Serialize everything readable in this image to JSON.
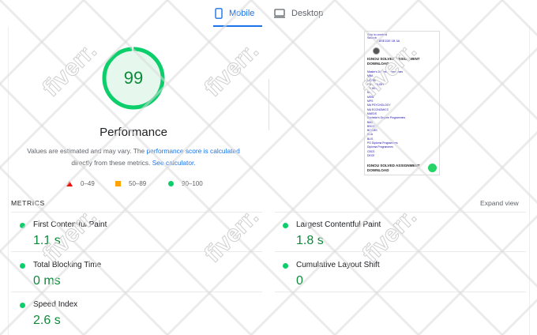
{
  "tabs": [
    {
      "label": "Mobile",
      "icon": "smartphone-icon",
      "active": true
    },
    {
      "label": "Desktop",
      "icon": "monitor-icon",
      "active": false
    }
  ],
  "score": {
    "value": "99",
    "level": 0.99,
    "label": "Performance",
    "note_part1": "Values are estimated and may vary. The ",
    "note_link1": "performance score is calculated",
    "note_part2": " directly from these metrics. ",
    "note_link2": "See calculator.",
    "color_ring": "#0cce6b",
    "color_text": "#0c8a3a"
  },
  "legend": [
    {
      "range": "0–49",
      "shape": "triangle",
      "color": "#eb0f00"
    },
    {
      "range": "50–89",
      "shape": "square",
      "color": "#ffa400"
    },
    {
      "range": "90–100",
      "shape": "circle",
      "color": "#0cce6b"
    }
  ],
  "thumbnail": {
    "top_lines": [
      "Skip to content",
      "Search",
      "CBSE1DE 1B 3A"
    ],
    "title": "IGNOU SOLVED ASSIGNMENT DOWNLOAD",
    "links": [
      "Master's Degree Programmes",
      "MBA",
      "MCOM",
      "MA ENGLISH",
      "MA HINDI",
      "MCA",
      "MSW",
      "MPS",
      "MA PSYCHOLOGY",
      "MA ECONOMICS",
      "MAEDS",
      "Bachelor's Degree Programmes",
      "BAG",
      "BSCG",
      "BCOMG",
      "BCA",
      "BLIS",
      "PG Diploma Programmes",
      "Diploma Programmes",
      "CBCS",
      "DECE"
    ],
    "bottom_title": "IGNOU SOLVED ASSIGNMENT DOWNLOAD"
  },
  "metrics": {
    "header": "METRICS",
    "expand_label": "Expand view",
    "items": [
      {
        "label": "First Contentful Paint",
        "value": "1.1 s",
        "status_color": "#0cce6b"
      },
      {
        "label": "Largest Contentful Paint",
        "value": "1.8 s",
        "status_color": "#0cce6b"
      },
      {
        "label": "Total Blocking Time",
        "value": "0 ms",
        "status_color": "#0cce6b"
      },
      {
        "label": "Cumulative Layout Shift",
        "value": "0",
        "status_color": "#0cce6b"
      },
      {
        "label": "Speed Index",
        "value": "2.6 s",
        "status_color": "#0cce6b"
      }
    ]
  },
  "watermark": {
    "text": "fiverr."
  },
  "colors": {
    "accent": "#1a73e8",
    "pass": "#0cce6b",
    "pass_text": "#0c8a3a",
    "average": "#ffa400",
    "fail": "#eb0f00"
  }
}
